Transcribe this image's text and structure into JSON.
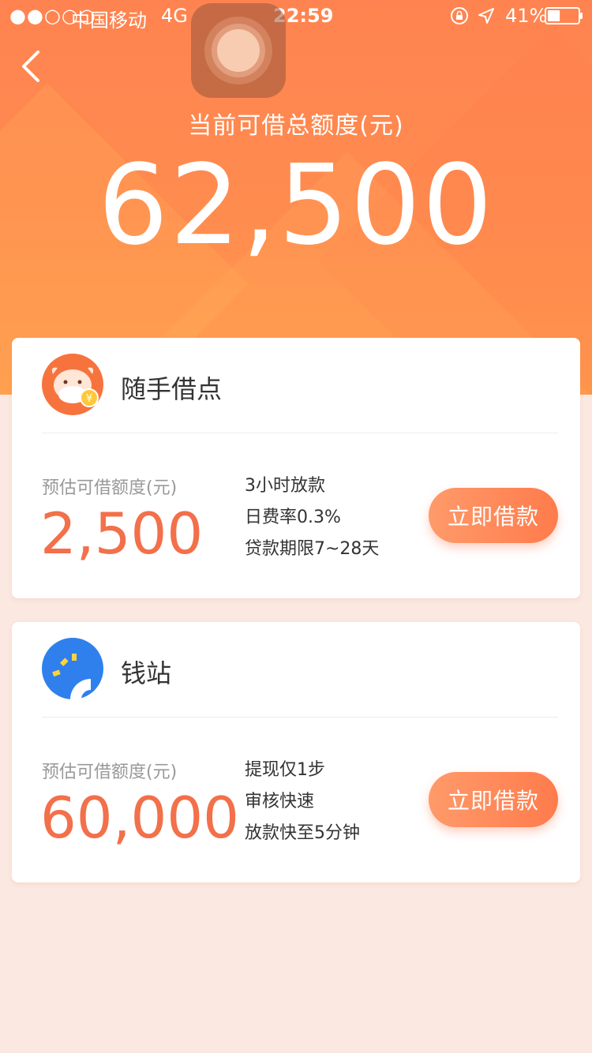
{
  "status_bar": {
    "signal": "●●○○○",
    "carrier": "中国移动",
    "network": "4G",
    "time": "22:59",
    "battery_percent": "41%",
    "battery_level": 0.41
  },
  "header": {
    "total_label": "当前可借总额度(元)",
    "total_amount": "62,500",
    "back_icon": "chevron-left-icon"
  },
  "colors": {
    "header_orange": "#ff8350",
    "amount_orange": "#f2704a",
    "page_background": "#fbe8e0"
  },
  "products": [
    {
      "name": "随手借点",
      "logo_icon": "cow-coin-icon",
      "amount_label": "预估可借额度(元)",
      "amount": "2,500",
      "features": [
        "3小时放款",
        "日费率0.3%",
        "贷款期限7~28天"
      ],
      "button_label": "立即借款"
    },
    {
      "name": "钱站",
      "logo_icon": "qianzhan-logo-icon",
      "amount_label": "预估可借额度(元)",
      "amount": "60,000",
      "features": [
        "提现仅1步",
        "审核快速",
        "放款快至5分钟"
      ],
      "button_label": "立即借款"
    }
  ]
}
